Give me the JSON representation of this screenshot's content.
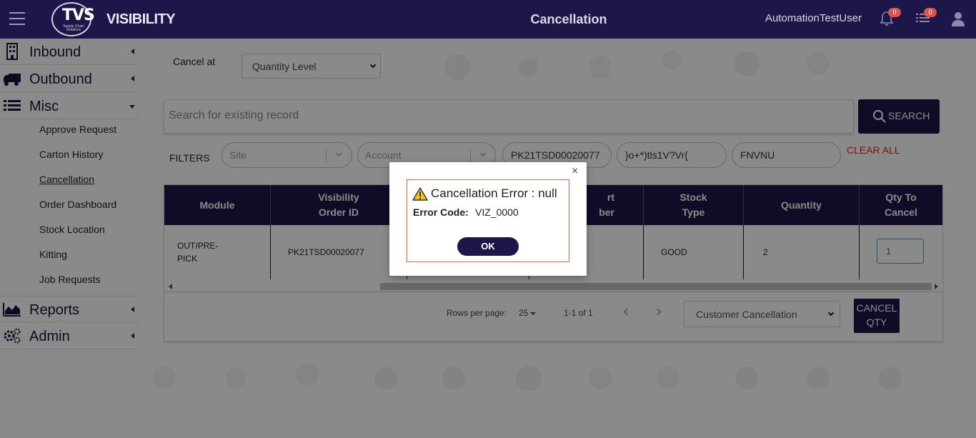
{
  "header": {
    "logo_text": "TVS",
    "logo_sub": "Supply Chain Solutions",
    "brand": "VISIBILITY",
    "title": "Cancellation",
    "username": "AutomationTestUser",
    "notifications_count": "0",
    "tasks_count": "0"
  },
  "sidebar": {
    "main": [
      {
        "label": "Inbound",
        "icon": "building-icon"
      },
      {
        "label": "Outbound",
        "icon": "truck-icon"
      },
      {
        "label": "Misc",
        "icon": "list-icon"
      },
      {
        "label": "Reports",
        "icon": "area-chart-icon"
      },
      {
        "label": "Admin",
        "icon": "gears-icon"
      }
    ],
    "misc_items": [
      "Approve Request",
      "Carton History",
      "Cancellation",
      "Order Dashboard",
      "Stock Location",
      "Kitting",
      "Job Requests"
    ],
    "active_item": "Cancellation"
  },
  "form": {
    "cancel_at_label": "Cancel at",
    "cancel_at_value": "Quantity Level",
    "search_placeholder": "Search for existing record",
    "search_button": "SEARCH",
    "filters_label": "FILTERS",
    "site_placeholder": "Site",
    "account_placeholder": "Account",
    "filter_tags": [
      "PK21TSD00020077",
      "}o+*)tls1V?Vr{",
      "FNVNU"
    ],
    "clear_all": "CLEAR ALL"
  },
  "table": {
    "headers": [
      "Module",
      "Visibility Order ID",
      "",
      "rt ber",
      "Stock Type",
      "Quantity",
      "Qty To Cancel"
    ],
    "header_module": "Module",
    "header_vis_1": "Visibility",
    "header_vis_2": "Order ID",
    "header_part_1": "rt",
    "header_part_2": "ber",
    "header_stock_1": "Stock",
    "header_stock_2": "Type",
    "header_quantity": "Quantity",
    "header_qty_1": "Qty To",
    "header_qty_2": "Cancel",
    "row": {
      "module_1": "OUT/PRE-",
      "module_2": "PICK",
      "order_id": "PK21TSD00020077",
      "stock_type": "GOOD",
      "quantity": "2",
      "qty_to_cancel": "1"
    },
    "rows_per_page_label": "Rows per page:",
    "rows_per_page": "25",
    "range": "1-1 of 1",
    "cancel_reason": "Customer Cancellation",
    "cancel_btn_1": "CANCEL",
    "cancel_btn_2": "QTY"
  },
  "modal": {
    "title": "Cancellation Error : null",
    "code_label": "Error Code:",
    "code_value": "VIZ_0000",
    "ok": "OK",
    "close": "×"
  },
  "colors": {
    "primary": "#1c1748",
    "danger": "#e02020",
    "modal_border": "#e0603a",
    "badge": "#d9534f"
  }
}
